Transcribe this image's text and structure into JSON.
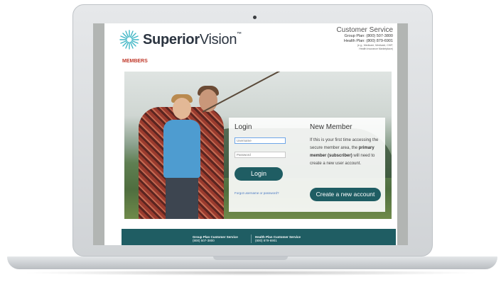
{
  "brand": {
    "name_bold": "Superior",
    "name_light": "Vision",
    "trademark": "™"
  },
  "customer_service": {
    "title": "Customer Service",
    "group_plan": "Group Plan: (800) 507-3800",
    "health_plan": "Health Plan: (800) 879-6901",
    "note1": "(e.g., Medicare, Medicaid, CHIP,",
    "note2": "Health Insurance Marketplace)"
  },
  "section_label": "MEMBERS",
  "login": {
    "title": "Login",
    "username_placeholder": "Username",
    "password_placeholder": "Password",
    "button": "Login",
    "forgot_link": "Forgot username or password?"
  },
  "new_member": {
    "title": "New Member",
    "text_1": "If this is your first time accessing the secure member area, the ",
    "text_bold": "primary member (subscriber)",
    "text_2": " will need to create a new user account.",
    "button": "Create a new account"
  },
  "footer": {
    "group_title": "Group Plan Customer Service",
    "group_phone": "(800) 507-3800",
    "health_title": "Health Plan Customer Service",
    "health_phone": "(800) 879-6901"
  },
  "colors": {
    "accent": "#1f5d63",
    "members_label": "#c0392b",
    "link": "#4a79c2"
  }
}
